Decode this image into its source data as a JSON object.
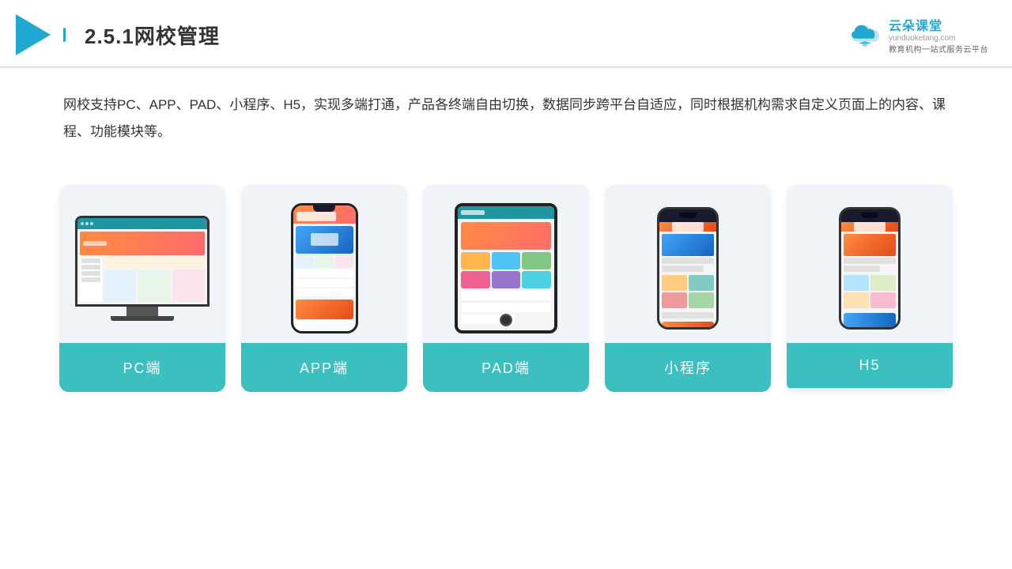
{
  "header": {
    "title": "2.5.1网校管理",
    "logo_main": "云朵课堂",
    "logo_sub": "教育机构一站式服务云平台",
    "logo_domain": "yunduoketang.com"
  },
  "description": "网校支持PC、APP、PAD、小程序、H5，实现多端打通，产品各终端自由切换，数据同步跨平台自适应，同时根据机构需求自定义页面上的内容、课程、功能模块等。",
  "cards": [
    {
      "id": "pc",
      "label": "PC端"
    },
    {
      "id": "app",
      "label": "APP端"
    },
    {
      "id": "pad",
      "label": "PAD端"
    },
    {
      "id": "miniapp",
      "label": "小程序"
    },
    {
      "id": "h5",
      "label": "H5"
    }
  ]
}
